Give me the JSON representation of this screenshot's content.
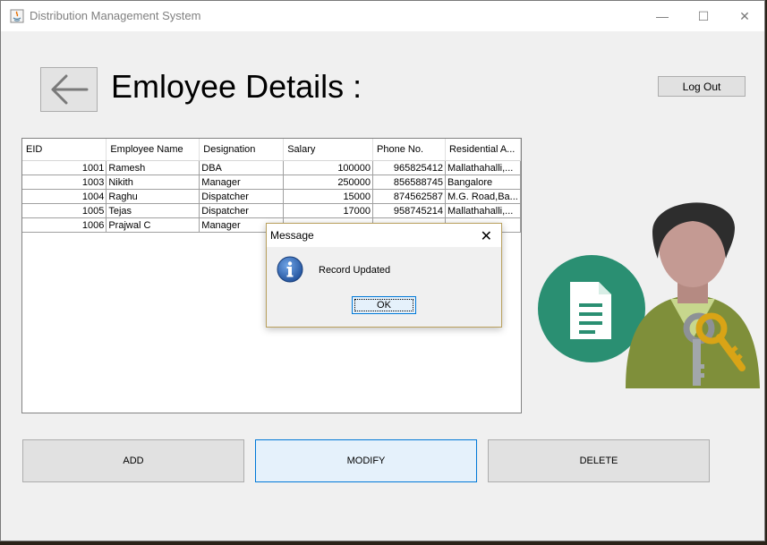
{
  "window": {
    "title": "Distribution Management System",
    "minimize_glyph": "—",
    "maximize_glyph": "☐",
    "close_glyph": "✕"
  },
  "header": {
    "title": "Emloyee Details :",
    "logout_label": "Log Out"
  },
  "table": {
    "columns": [
      "EID",
      "Employee Name",
      "Designation",
      "Salary",
      "Phone No.",
      "Residential A..."
    ],
    "rows": [
      [
        "1001",
        "Ramesh",
        "DBA",
        "100000",
        "965825412",
        "Mallathahalli,..."
      ],
      [
        "1003",
        "Nikith",
        "Manager",
        "250000",
        "856588745",
        "Bangalore"
      ],
      [
        "1004",
        "Raghu",
        "Dispatcher",
        "15000",
        "874562587",
        "M.G. Road,Ba..."
      ],
      [
        "1005",
        "Tejas",
        "Dispatcher",
        "17000",
        "958745214",
        "Mallathahalli,..."
      ],
      [
        "1006",
        "Prajwal C",
        "Manager",
        "",
        "",
        ""
      ]
    ]
  },
  "actions": {
    "add_label": "ADD",
    "modify_label": "MODIFY",
    "delete_label": "DELETE"
  },
  "dialog": {
    "title": "Message",
    "message": "Record Updated",
    "ok_label": "OK",
    "close_glyph": "✕"
  },
  "icons": {
    "back": "back-arrow-icon",
    "illustration": "employee-key-document-icon",
    "info": "info-icon",
    "app": "java-icon"
  },
  "colors": {
    "teal_circle": "#2a8f72",
    "info_blue": "#1f5fb0",
    "key_gold": "#d9a416",
    "dialog_border": "#b9a05d",
    "focus_blue": "#0078d7"
  }
}
